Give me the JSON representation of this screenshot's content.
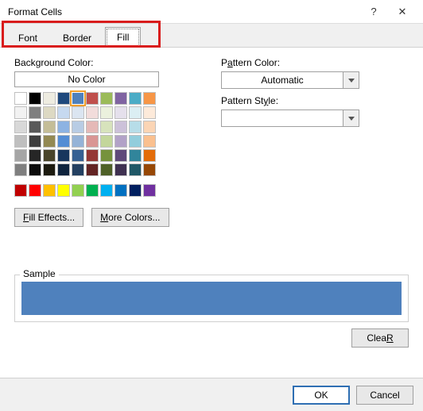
{
  "window": {
    "title": "Format Cells",
    "help": "?",
    "close": "✕"
  },
  "tabs": {
    "font": "Font",
    "border": "Border",
    "fill": "Fill"
  },
  "left": {
    "bgcolor_label_pre": "Back",
    "bgcolor_label_ul": "g",
    "bgcolor_label_post": "round Color:",
    "nocolor": "No Color",
    "fill_effects_ul": "F",
    "fill_effects_rest": "ill Effects...",
    "more_ul": "M",
    "more_rest": "ore Colors..."
  },
  "right": {
    "pcolor_label_pre": "P",
    "pcolor_label_ul": "a",
    "pcolor_label_post": "ttern Color:",
    "pcolor_value": "Automatic",
    "pstyle_label_pre": "Pattern St",
    "pstyle_label_ul": "y",
    "pstyle_label_post": "le:",
    "pstyle_value": ""
  },
  "sample": {
    "legend": "Sample",
    "color": "#4f81bd"
  },
  "buttons": {
    "clear_ul": "R",
    "clear_pre": "Clea",
    "clear_post": "",
    "ok": "OK",
    "cancel": "Cancel"
  },
  "theme_colors_rows": [
    [
      "#ffffff",
      "#000000",
      "#eeece1",
      "#1f497d",
      "#4f81bd",
      "#c0504d",
      "#9bbb59",
      "#8064a2",
      "#4bacc6",
      "#f79646"
    ],
    [
      "#f2f2f2",
      "#7f7f7f",
      "#ddd9c3",
      "#c6d9f0",
      "#dbe5f1",
      "#f2dcdb",
      "#ebf1dd",
      "#e5e0ec",
      "#dbeef3",
      "#fdeada"
    ],
    [
      "#d8d8d8",
      "#595959",
      "#c4bd97",
      "#8db3e2",
      "#b8cce4",
      "#e5b9b7",
      "#d7e3bc",
      "#ccc1d9",
      "#b7dde8",
      "#fbd5b5"
    ],
    [
      "#bfbfbf",
      "#3f3f3f",
      "#938953",
      "#548dd4",
      "#95b3d7",
      "#d99694",
      "#c3d69b",
      "#b2a2c7",
      "#92cddc",
      "#fac08f"
    ],
    [
      "#a5a5a5",
      "#262626",
      "#494429",
      "#17365d",
      "#366092",
      "#953734",
      "#76923c",
      "#5f497a",
      "#31859b",
      "#e36c09"
    ],
    [
      "#7f7f7f",
      "#0c0c0c",
      "#1d1b10",
      "#0f243e",
      "#244061",
      "#632423",
      "#4f6128",
      "#3f3151",
      "#205867",
      "#974806"
    ]
  ],
  "standard_colors": [
    "#c00000",
    "#ff0000",
    "#ffc000",
    "#ffff00",
    "#92d050",
    "#00b050",
    "#00b0f0",
    "#0070c0",
    "#002060",
    "#7030a0"
  ],
  "selected_theme": {
    "row": 0,
    "col": 4
  }
}
